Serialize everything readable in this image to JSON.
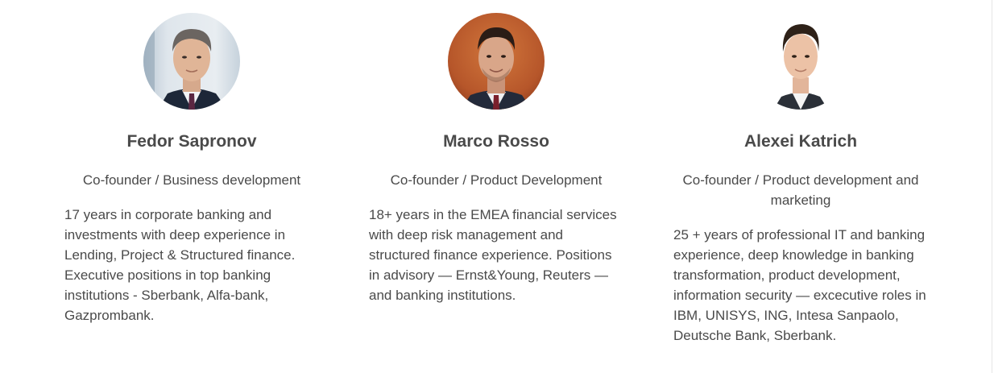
{
  "team": [
    {
      "name": "Fedor Sapronov",
      "role": "Co-founder / Business development",
      "bio": "17 years in corporate banking and investments with deep experience in Lending, Project & Structured finance. Executive positions in top banking institutions - Sberbank, Alfa-bank, Gazprombank."
    },
    {
      "name": "Marco Rosso",
      "role": "Co-founder / Product Development",
      "bio": "18+ years in the EMEA financial services with deep risk management and structured finance experience. Positions in advisory — Ernst&Young, Reuters — and banking institutions."
    },
    {
      "name": "Alexei Katrich",
      "role": "Co-founder / Product development and marketing",
      "bio": "25 + years of professional IT and banking experience, deep knowledge in banking transformation, product development, information security — excecutive roles in IBM, UNISYS, ING, Intesa Sanpaolo, Deutsche Bank, Sberbank."
    }
  ]
}
